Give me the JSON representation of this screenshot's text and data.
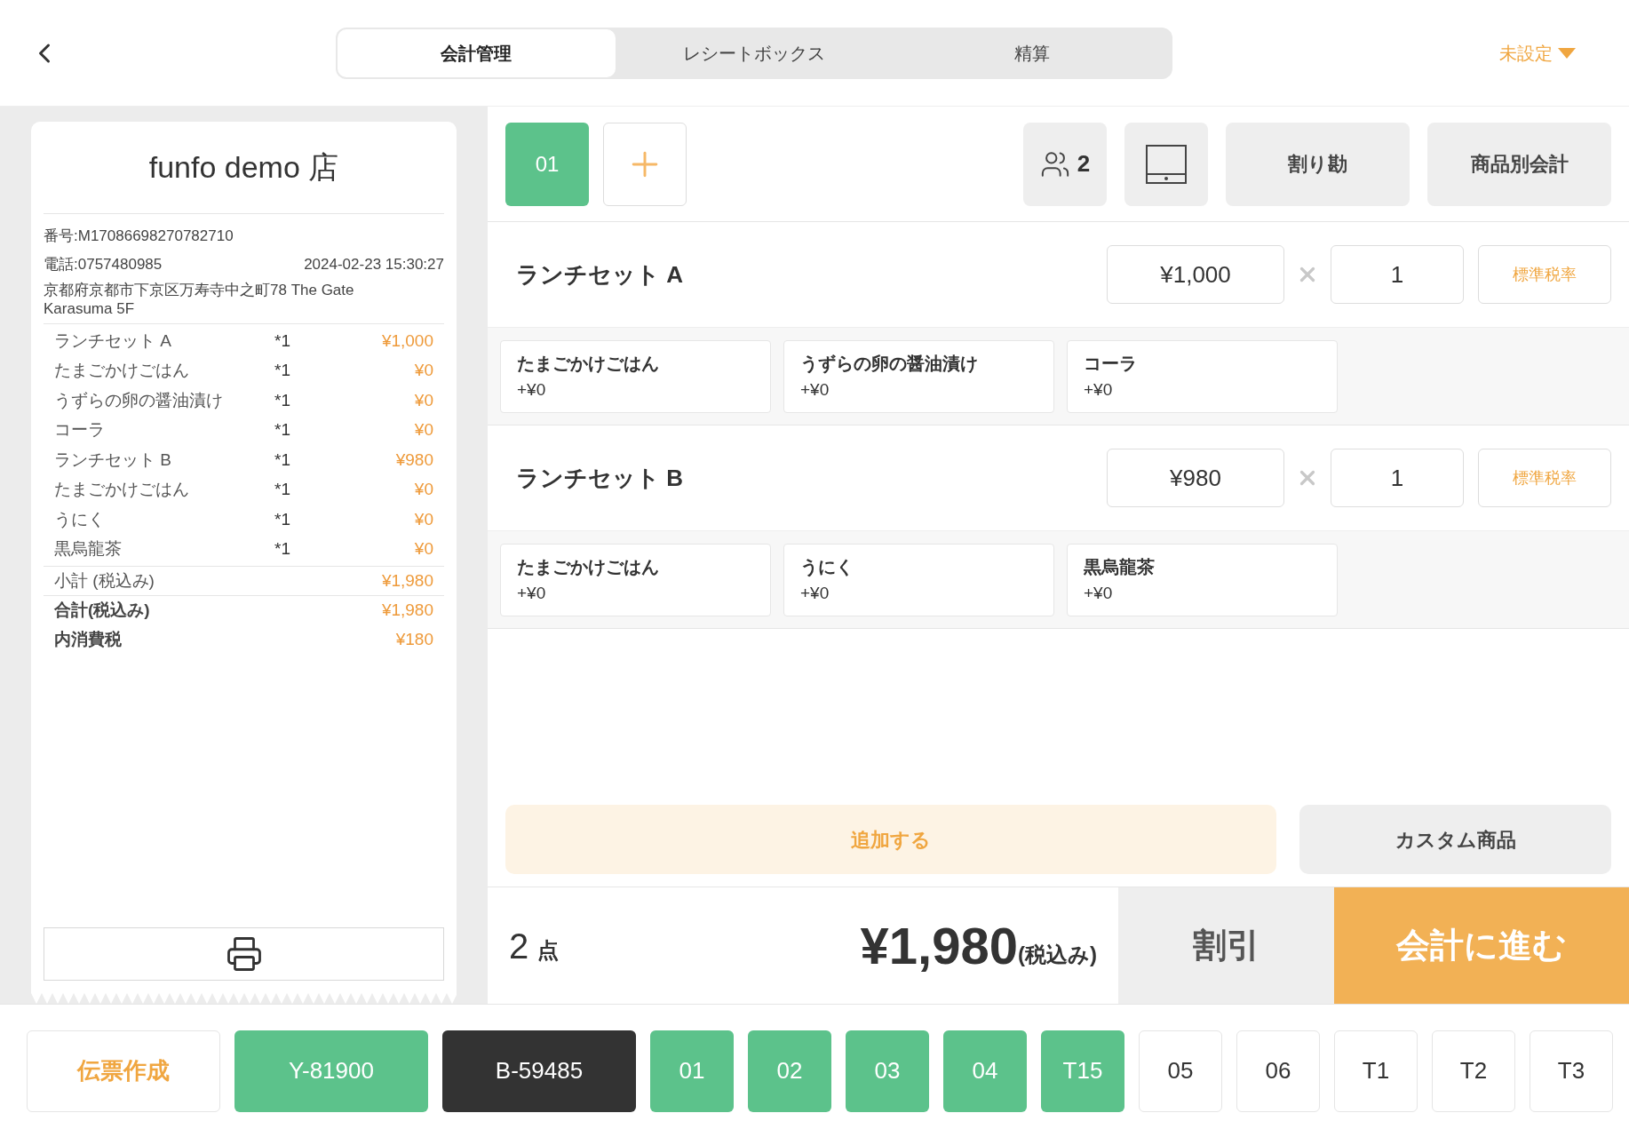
{
  "tabs": [
    {
      "label": "会計管理",
      "selected": true
    },
    {
      "label": "レシートボックス",
      "selected": false
    },
    {
      "label": "精算",
      "selected": false
    }
  ],
  "store_selector": {
    "label": "未設定"
  },
  "receipt": {
    "store_name": "funfo demo 店",
    "number": "番号:M17086698270782710",
    "phone": "電話:0757480985",
    "datetime": "2024-02-23 15:30:27",
    "address": "京都府京都市下京区万寿寺中之町78 The Gate Karasuma 5F",
    "lines": [
      {
        "name": "ランチセット A",
        "qty": "*1",
        "price": "¥1,000"
      },
      {
        "name": "たまごかけごはん",
        "qty": "*1",
        "price": "¥0"
      },
      {
        "name": "うずらの卵の醤油漬け",
        "qty": "*1",
        "price": "¥0"
      },
      {
        "name": "コーラ",
        "qty": "*1",
        "price": "¥0"
      },
      {
        "name": "ランチセット B",
        "qty": "*1",
        "price": "¥980"
      },
      {
        "name": "たまごかけごはん",
        "qty": "*1",
        "price": "¥0"
      },
      {
        "name": "うにく",
        "qty": "*1",
        "price": "¥0"
      },
      {
        "name": "黒烏龍茶",
        "qty": "*1",
        "price": "¥0"
      }
    ],
    "totals": [
      {
        "label": "小計 (税込み)",
        "value": "¥1,980"
      },
      {
        "label": "合計(税込み)",
        "value": "¥1,980"
      },
      {
        "label": "内消費税",
        "value": "¥180"
      }
    ]
  },
  "order_tabs": [
    {
      "label": "01",
      "selected": true
    }
  ],
  "guests": {
    "count": "2"
  },
  "actions": [
    "割り勘",
    "商品別会計"
  ],
  "items": [
    {
      "name": "ランチセット A",
      "price": "¥1,000",
      "quantity": "1",
      "tax_label": "標準税率",
      "options": [
        {
          "name": "たまごかけごはん",
          "price": "+¥0"
        },
        {
          "name": "うずらの卵の醤油漬け",
          "price": "+¥0"
        },
        {
          "name": "コーラ",
          "price": "+¥0"
        }
      ]
    },
    {
      "name": "ランチセット B",
      "price": "¥980",
      "quantity": "1",
      "tax_label": "標準税率",
      "options": [
        {
          "name": "たまごかけごはん",
          "price": "+¥0"
        },
        {
          "name": "うにく",
          "price": "+¥0"
        },
        {
          "name": "黒烏龍茶",
          "price": "+¥0"
        }
      ]
    }
  ],
  "add_button": "追加する",
  "custom_button": "カスタム商品",
  "summary": {
    "count": "2",
    "unit": "点",
    "total": "¥1,980",
    "tax_note": "(税込み)"
  },
  "discount_button": "割引",
  "checkout_button": "会計に進む",
  "tables": [
    {
      "label": "伝票作成",
      "kind": "action"
    },
    {
      "label": "Y-81900",
      "kind": "occupied"
    },
    {
      "label": "B-59485",
      "kind": "current"
    },
    {
      "label": "01",
      "kind": "occupied"
    },
    {
      "label": "02",
      "kind": "occupied"
    },
    {
      "label": "03",
      "kind": "occupied"
    },
    {
      "label": "04",
      "kind": "occupied"
    },
    {
      "label": "T15",
      "kind": "occupied"
    },
    {
      "label": "05",
      "kind": "vacant"
    },
    {
      "label": "06",
      "kind": "vacant"
    },
    {
      "label": "T1",
      "kind": "vacant"
    },
    {
      "label": "T2",
      "kind": "vacant"
    },
    {
      "label": "T3",
      "kind": "vacant"
    }
  ]
}
